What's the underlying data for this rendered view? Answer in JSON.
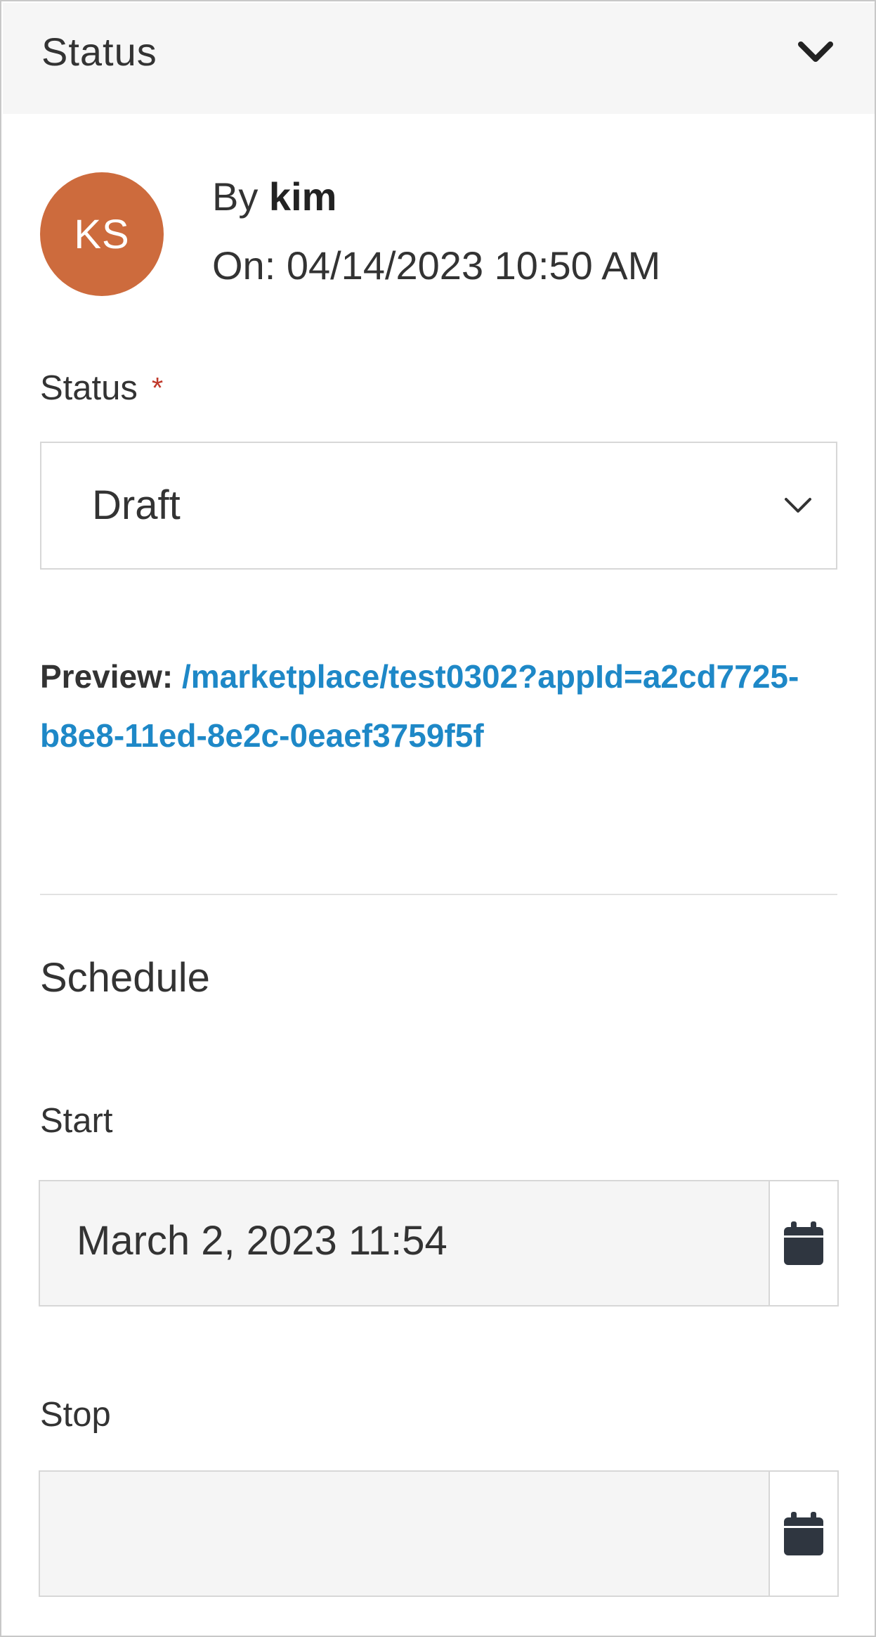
{
  "header": {
    "title": "Status",
    "collapse_icon": "chevron-down-icon"
  },
  "author": {
    "avatar_initials": "KS",
    "avatar_color": "#cd6b3d",
    "by_prefix": "By",
    "name": "kim",
    "on_text": "On: 04/14/2023 10:50 AM"
  },
  "status_field": {
    "label": "Status",
    "required_marker": "*",
    "value": "Draft"
  },
  "preview": {
    "label": "Preview:",
    "link": "/marketplace/test0302?appId=a2cd7725-b8e8-11ed-8e2c-0eaef3759f5f",
    "link_color": "#1e88c7"
  },
  "schedule": {
    "title": "Schedule",
    "start_label": "Start",
    "start_value": "March 2, 2023 11:54",
    "stop_label": "Stop",
    "stop_value": "",
    "calendar_icon": "calendar-icon"
  }
}
